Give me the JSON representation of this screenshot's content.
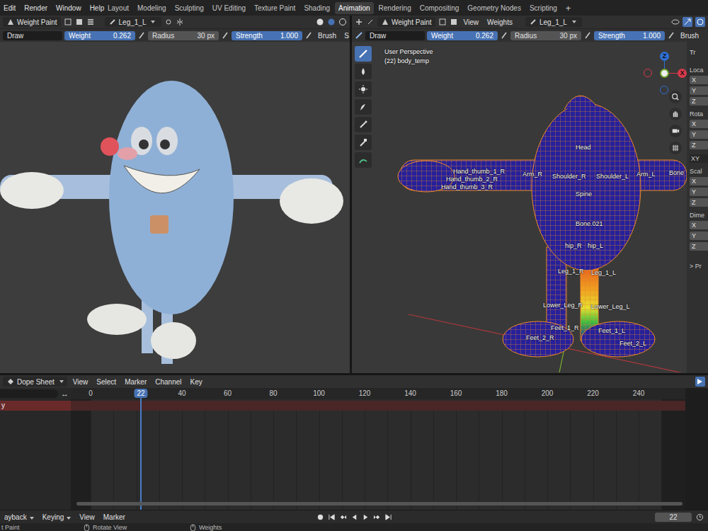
{
  "top_bar": {
    "menus": [
      "Edit",
      "Render",
      "Window",
      "Help"
    ],
    "workspaces": [
      {
        "label": "Layout",
        "selected": false
      },
      {
        "label": "Modeling",
        "selected": false
      },
      {
        "label": "Sculpting",
        "selected": false
      },
      {
        "label": "UV Editing",
        "selected": false
      },
      {
        "label": "Texture Paint",
        "selected": false
      },
      {
        "label": "Shading",
        "selected": false
      },
      {
        "label": "Animation",
        "selected": true
      },
      {
        "label": "Rendering",
        "selected": false
      },
      {
        "label": "Compositing",
        "selected": false
      },
      {
        "label": "Geometry Nodes",
        "selected": false
      },
      {
        "label": "Scripting",
        "selected": false
      }
    ],
    "add": "+"
  },
  "left_viewport": {
    "mode": "Weight Paint",
    "active_bone": "Leg_1_L",
    "tool": "Draw",
    "fields": [
      {
        "label": "Weight",
        "value": "0.262",
        "highlighted": true
      },
      {
        "label": "Radius",
        "value": "30 px",
        "highlighted": false
      },
      {
        "label": "Strength",
        "value": "1.000",
        "highlighted": true
      }
    ],
    "brush": "Brush",
    "cut_label": "S"
  },
  "right_viewport": {
    "mode": "Weight Paint",
    "menus": [
      "View",
      "Weights"
    ],
    "active_bone": "Leg_1_L",
    "tool": "Draw",
    "fields": [
      {
        "label": "Weight",
        "value": "0.262",
        "highlighted": true
      },
      {
        "label": "Radius",
        "value": "30 px",
        "highlighted": false
      },
      {
        "label": "Strength",
        "value": "1.000",
        "highlighted": true
      }
    ],
    "brush": "Brush",
    "tools": [
      {
        "selected": true
      },
      {
        "selected": false
      },
      {
        "selected": false
      },
      {
        "selected": false
      },
      {
        "selected": false
      },
      {
        "selected": false
      },
      {
        "selected": false
      }
    ],
    "view_name": "User Perspective",
    "object": "(22) body_temp",
    "gizmo": [
      {
        "label": "Z",
        "color": "#2e6fd3"
      },
      {
        "label": "X",
        "color": "#d8394a"
      }
    ],
    "bones": [
      "Head",
      "Shoulder_R",
      "Shoulder_L",
      "Arm_R",
      "Arm_L",
      "Bone",
      "Spine",
      "Bone.021",
      "hip_R",
      "hip_L",
      "Leg_1_R",
      "Leg_1_L",
      "Lower_Leg_R",
      "Lower_Leg_L",
      "Feet_1_R",
      "Feet_1_L",
      "Feet_2_R",
      "Feet_2_L",
      "Hand_thumb_1_R",
      "Hand_thumb_2_R",
      "Hand_thumb_3_R"
    ]
  },
  "sidebar": {
    "tab": "Tr",
    "groups": [
      {
        "label": "Loca",
        "rows": [
          "X",
          "Y",
          "Z"
        ]
      },
      {
        "label": "Rota",
        "rows": [
          "X",
          "Y",
          "Z"
        ]
      },
      {
        "label": "XY",
        "rows": []
      },
      {
        "label": "Scal",
        "rows": [
          "X",
          "Y",
          "Z"
        ]
      },
      {
        "label": "Dime",
        "rows": [
          "X",
          "Y",
          "Z"
        ]
      }
    ],
    "more_icon": ">",
    "more": "Pr"
  },
  "dope_sheet": {
    "editor": "Dope Sheet",
    "menus": [
      "View",
      "Select",
      "Marker",
      "Channel",
      "Key"
    ],
    "swap_icon": "↔",
    "frames": [
      "0",
      "40",
      "60",
      "80",
      "100",
      "120",
      "140",
      "160",
      "180",
      "200",
      "220",
      "240"
    ],
    "current": "22",
    "channel": "y"
  },
  "playback_bar": {
    "menus": [
      {
        "label": "ayback",
        "dropdown": true
      },
      {
        "label": "Keying",
        "dropdown": true
      },
      {
        "label": "View",
        "dropdown": false
      },
      {
        "label": "Marker",
        "dropdown": false
      }
    ],
    "frame": "22"
  },
  "status_bar": {
    "items": [
      "t Paint",
      "Rotate View",
      "Weights"
    ]
  }
}
